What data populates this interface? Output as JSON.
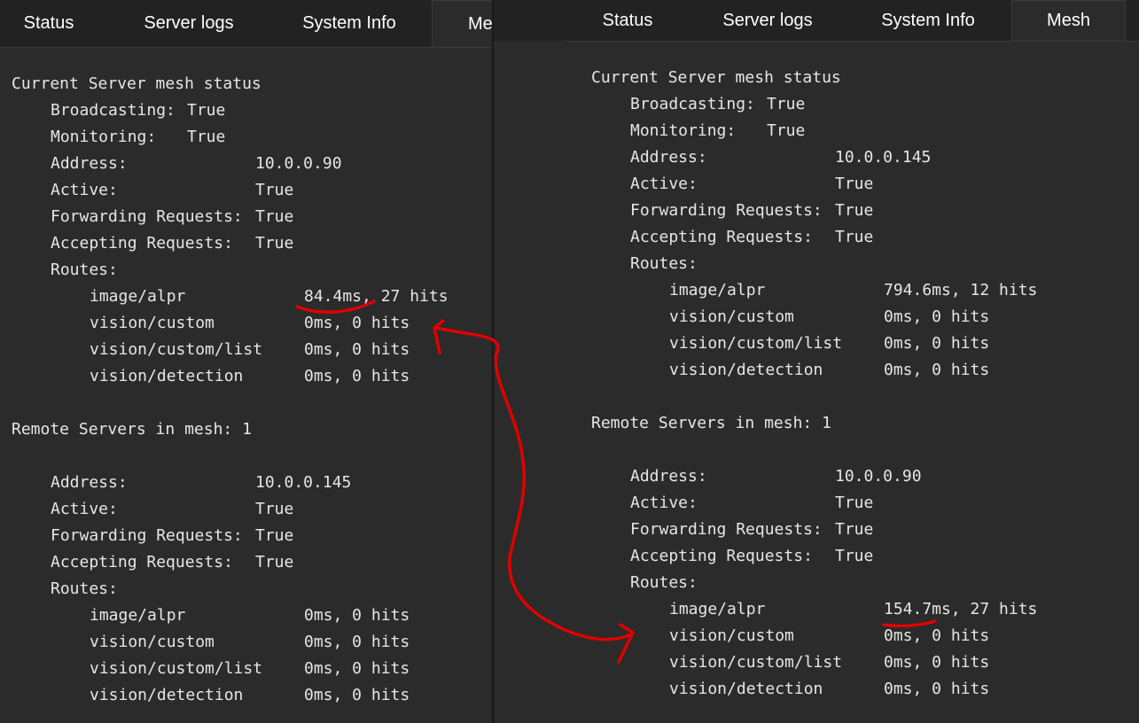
{
  "tabs": {
    "status": "Status",
    "server_logs": "Server logs",
    "system_info": "System Info",
    "mesh": "Mesh",
    "mesh_truncated": "Mes"
  },
  "left": {
    "heading": "Current Server mesh status",
    "local": {
      "broadcasting_label": "Broadcasting:",
      "broadcasting": "True",
      "monitoring_label": "Monitoring:",
      "monitoring": "True",
      "address_label": "Address:",
      "address": "10.0.0.90",
      "active_label": "Active:",
      "active": "True",
      "forwarding_label": "Forwarding Requests:",
      "forwarding": "True",
      "accepting_label": "Accepting Requests:",
      "accepting": "True",
      "routes_label": "Routes:",
      "routes": [
        {
          "name": "image/alpr",
          "stats": "84.4ms, 27 hits"
        },
        {
          "name": "vision/custom",
          "stats": "0ms, 0 hits"
        },
        {
          "name": "vision/custom/list",
          "stats": "0ms, 0 hits"
        },
        {
          "name": "vision/detection",
          "stats": "0ms, 0 hits"
        }
      ]
    },
    "remote_heading": "Remote Servers in mesh: 1",
    "remote": {
      "address_label": "Address:",
      "address": "10.0.0.145",
      "active_label": "Active:",
      "active": "True",
      "forwarding_label": "Forwarding Requests:",
      "forwarding": "True",
      "accepting_label": "Accepting Requests:",
      "accepting": "True",
      "routes_label": "Routes:",
      "routes": [
        {
          "name": "image/alpr",
          "stats": "0ms, 0 hits"
        },
        {
          "name": "vision/custom",
          "stats": "0ms, 0 hits"
        },
        {
          "name": "vision/custom/list",
          "stats": "0ms, 0 hits"
        },
        {
          "name": "vision/detection",
          "stats": "0ms, 0 hits"
        }
      ]
    }
  },
  "right": {
    "heading": "Current Server mesh status",
    "local": {
      "broadcasting_label": "Broadcasting:",
      "broadcasting": "True",
      "monitoring_label": "Monitoring:",
      "monitoring": "True",
      "address_label": "Address:",
      "address": "10.0.0.145",
      "active_label": "Active:",
      "active": "True",
      "forwarding_label": "Forwarding Requests:",
      "forwarding": "True",
      "accepting_label": "Accepting Requests:",
      "accepting": "True",
      "routes_label": "Routes:",
      "routes": [
        {
          "name": "image/alpr",
          "stats": "794.6ms, 12 hits"
        },
        {
          "name": "vision/custom",
          "stats": "0ms, 0 hits"
        },
        {
          "name": "vision/custom/list",
          "stats": "0ms, 0 hits"
        },
        {
          "name": "vision/detection",
          "stats": "0ms, 0 hits"
        }
      ]
    },
    "remote_heading": "Remote Servers in mesh: 1",
    "remote": {
      "address_label": "Address:",
      "address": "10.0.0.90",
      "active_label": "Active:",
      "active": "True",
      "forwarding_label": "Forwarding Requests:",
      "forwarding": "True",
      "accepting_label": "Accepting Requests:",
      "accepting": "True",
      "routes_label": "Routes:",
      "routes": [
        {
          "name": "image/alpr",
          "stats": "154.7ms, 27 hits"
        },
        {
          "name": "vision/custom",
          "stats": "0ms, 0 hits"
        },
        {
          "name": "vision/custom/list",
          "stats": "0ms, 0 hits"
        },
        {
          "name": "vision/detection",
          "stats": "0ms, 0 hits"
        }
      ]
    }
  },
  "colors": {
    "background": "#2b2b2b",
    "tabbar": "#222222",
    "text": "#e6e6e6",
    "annotation": "#e00000"
  }
}
